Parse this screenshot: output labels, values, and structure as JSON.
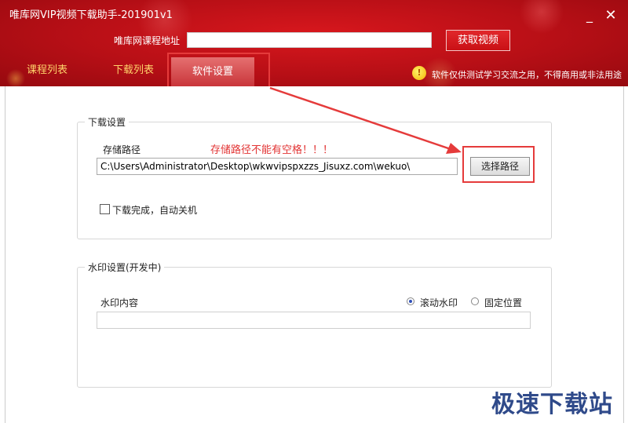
{
  "window": {
    "title": "唯库网VIP视频下载助手-201901v1",
    "minimize_glyph": "_",
    "close_glyph": "✕"
  },
  "header": {
    "url_label": "唯库网课程地址",
    "url_value": "",
    "fetch_button": "获取视频",
    "tabs": [
      {
        "label": "课程列表",
        "active": false
      },
      {
        "label": "下载列表",
        "active": false
      },
      {
        "label": "软件设置",
        "active": true
      }
    ],
    "notice_icon_glyph": "!",
    "notice": "软件仅供测试学习交流之用，不得商用或非法用途"
  },
  "download_settings": {
    "group_title": "下载设置",
    "path_label": "存储路径",
    "warning": "存储路径不能有空格！！！",
    "path_value": "C:\\Users\\Administrator\\Desktop\\wkwvipspxzzs_Jisuxz.com\\wekuo\\",
    "choose_button": "选择路径",
    "shutdown_label": "下载完成，自动关机",
    "shutdown_checked": false
  },
  "watermark_settings": {
    "group_title": "水印设置(开发中)",
    "content_label": "水印内容",
    "options": [
      {
        "label": "滚动水印",
        "selected": true
      },
      {
        "label": "固定位置",
        "selected": false
      }
    ],
    "content_value": ""
  },
  "site_watermark": "极速下载站",
  "colors": {
    "header_red": "#c41219",
    "highlight_red": "#e53b3b",
    "tab_inactive": "#ffd36b"
  }
}
